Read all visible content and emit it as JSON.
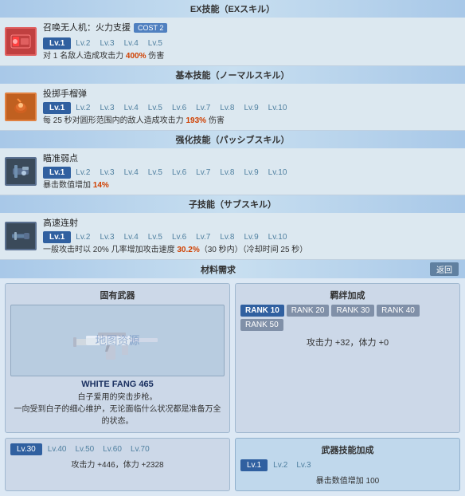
{
  "sections": {
    "ex_skill": {
      "header": "EX技能（EXスキル）",
      "icon_type": "red",
      "icon_symbol": "≋",
      "name": "召唤无人机：火力支援",
      "cost_label": "COST 2",
      "levels": [
        "Lv.1",
        "Lv.2",
        "Lv.3",
        "Lv.4",
        "Lv.5"
      ],
      "active_level": "Lv.1",
      "description": "对 1 名敌人造成攻击力 400% 伤害",
      "highlight": "400%"
    },
    "basic_skill": {
      "header": "基本技能（ノーマルスキル）",
      "icon_type": "orange",
      "icon_symbol": "✦",
      "name": "投掷手榴弹",
      "levels": [
        "Lv.1",
        "Lv.2",
        "Lv.3",
        "Lv.4",
        "Lv.5",
        "Lv.6",
        "Lv.7",
        "Lv.8",
        "Lv.9",
        "Lv.10"
      ],
      "active_level": "Lv.1",
      "description": "每 25 秒对圆形范围内的敌人造成攻击力 193% 伤害",
      "highlight": "193%"
    },
    "enhance_skill": {
      "header": "强化技能（パッシブスキル）",
      "icon_type": "dark",
      "icon_symbol": "⊕",
      "name": "瞄准弱点",
      "levels": [
        "Lv.1",
        "Lv.2",
        "Lv.3",
        "Lv.4",
        "Lv.5",
        "Lv.6",
        "Lv.7",
        "Lv.8",
        "Lv.9",
        "Lv.10"
      ],
      "active_level": "Lv.1",
      "description": "暴击数值增加 14%",
      "highlight": "14%"
    },
    "sub_skill": {
      "header": "子技能（サブスキル）",
      "icon_type": "dark",
      "icon_symbol": "⚡",
      "name": "高速连射",
      "levels": [
        "Lv.1",
        "Lv.2",
        "Lv.3",
        "Lv.4",
        "Lv.5",
        "Lv.6",
        "Lv.7",
        "Lv.8",
        "Lv.9",
        "Lv.10"
      ],
      "active_level": "Lv.1",
      "description": "一般攻击时以 20% 几率增加攻击速度 30.2%（30 秒内）（冷却时间 25 秒）",
      "highlight": "30.2%"
    }
  },
  "materials": {
    "header": "材料需求",
    "return_label": "返回",
    "weapon_panel": {
      "title": "固有武器",
      "name": "WHITE FANG 465",
      "desc1": "白子爱用的突击步枪。",
      "desc2": "一向受到白子的细心维护，无论面临什么状况都是准备万全的状态。"
    },
    "bonus_panel": {
      "title": "羁绊加成",
      "ranks": [
        "RANK 10",
        "RANK 20",
        "RANK 30",
        "RANK 40",
        "RANK 50"
      ],
      "active_rank": "RANK 10",
      "stat": "攻击力 +32，体力 +0"
    }
  },
  "level_section": {
    "levels": [
      "Lv.30",
      "Lv.40",
      "Lv.50",
      "Lv.60",
      "Lv.70"
    ],
    "active_level": "Lv.30",
    "stat": "攻击力 +446，体力 +2328"
  },
  "weapon_skill": {
    "header": "武器技能加成",
    "levels": [
      "Lv.1",
      "Lv.2",
      "Lv.3"
    ],
    "active_level": "Lv.1",
    "stat": "暴击数值增加 100"
  }
}
